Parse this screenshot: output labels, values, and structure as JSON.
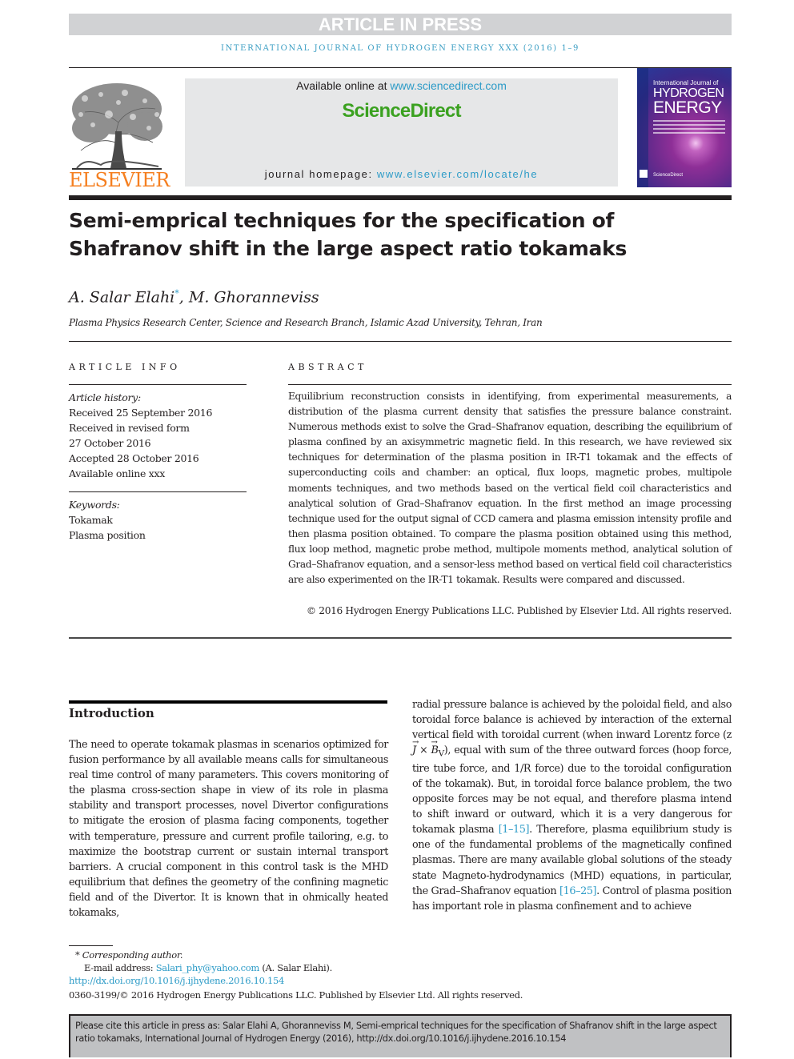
{
  "banner": {
    "label": "ARTICLE IN PRESS"
  },
  "running_head": "INTERNATIONAL JOURNAL OF HYDROGEN ENERGY XXX (2016) 1–9",
  "header": {
    "publisher_logo": "ELSEVIER",
    "available_online_prefix": "Available online at ",
    "available_online_link": "www.sciencedirect.com",
    "brand": "ScienceDirect",
    "homepage_prefix": "journal homepage: ",
    "homepage_link": "www.elsevier.com/locate/he",
    "cover": {
      "line1": "International Journal of",
      "line2": "HYDROGEN",
      "line3": "ENERGY",
      "footer": "ScienceDirect"
    }
  },
  "article": {
    "title": "Semi-emprical techniques for the specification of Shafranov shift in the large aspect ratio tokamaks",
    "authors": [
      {
        "name": "A. Salar Elahi",
        "mark": "*"
      },
      {
        "name": "M. Ghoranneviss",
        "mark": ""
      }
    ],
    "author_separator": ", ",
    "affiliation": "Plasma Physics Research Center, Science and Research Branch, Islamic Azad University, Tehran, Iran"
  },
  "article_info": {
    "heading": "ARTICLE INFO",
    "history_label": "Article history:",
    "history": [
      "Received 25 September 2016",
      "Received in revised form",
      "27 October 2016",
      "Accepted 28 October 2016",
      "Available online xxx"
    ],
    "keywords_label": "Keywords:",
    "keywords": [
      "Tokamak",
      "Plasma position"
    ]
  },
  "abstract": {
    "heading": "ABSTRACT",
    "text": "Equilibrium reconstruction consists in identifying, from experimental measurements, a distribution of the plasma current density that satisfies the pressure balance constraint. Numerous methods exist to solve the Grad–Shafranov equation, describing the equilib­rium of plasma confined by an axisymmetric magnetic field. In this research, we have reviewed six techniques for determination of the plasma position in IR-T1 tokamak and the effects of superconducting coils and chamber: an optical, flux loops, magnetic probes, multipole moments techniques, and two methods based on the vertical field coil charac­teristics and analytical solution of Grad–Shafranov equation. In the first method an image processing technique used for the output signal of CCD camera and plasma emission in­tensity profile and then plasma position obtained. To compare the plasma position ob­tained using this method, flux loop method, magnetic probe method, multipole moments method, analytical solution of Grad–Shafranov equation, and a sensor-less method based on vertical field coil characteristics are also experimented on the IR-T1 tokamak. Results were compared and discussed.",
    "copyright": "© 2016 Hydrogen Energy Publications LLC. Published by Elsevier Ltd. All rights reserved."
  },
  "body": {
    "section_heading": "Introduction",
    "left_column": "The need to operate tokamak plasmas in scenarios optimized for fusion performance by all available means calls for simultaneous real time control of many parameters. This covers monitoring of the plasma cross-section shape in view of its role in plasma stability and transport processes, novel Divertor configurations to mitigate the erosion of plasma facing components, together with temperature, pressure and current profile tailoring, e.g. to maximize the bootstrap cur­rent or sustain internal transport barriers. A crucial compo­nent in this control task is the MHD equilibrium that defines the geometry of the confining magnetic field and of the Divertor. It is known that in ohmically heated tokamaks,",
    "right_column": {
      "p1": "radial pressure balance is achieved by the poloidal field, and also toroidal force balance is achieved by interaction of the external vertical field with toroidal current (when inward Lorentz force (z",
      "vec_j": "J",
      "times": " × ",
      "vec_b": "B",
      "sub_v": "V",
      "p2": "), equal with sum of the three outward forces (hoop force, tire tube force, and 1/R force) due to the toroidal configuration of the tokamak). But, in toroidal force balance problem, the two opposite forces may be not equal, and therefore plasma intend to shift inward or outward, which it is a very dangerous for tokamak plasma ",
      "ref1": "[1–15]",
      "p3": ". Therefore, plasma equilibrium study is one of the funda­mental problems of the magnetically confined plasmas. There are many available global solutions of the steady state Magneto-hydrodynamics (MHD) equations, in particular, the Grad–Shafranov equation ",
      "ref2": "[16–25]",
      "p4": ". Control of plasma position has important role in plasma confinement and to achieve"
    }
  },
  "footnotes": {
    "corresponding": "* Corresponding author.",
    "email_label": "E-mail address: ",
    "email": "Salari_phy@yahoo.com",
    "email_owner": " (A. Salar Elahi).",
    "doi_link": "http://dx.doi.org/10.1016/j.ijhydene.2016.10.154",
    "issn_copyright": "0360-3199/© 2016 Hydrogen Energy Publications LLC. Published by Elsevier Ltd. All rights reserved."
  },
  "citation_box": "Please cite this article in press as: Salar Elahi A, Ghoranneviss M, Semi-emprical techniques for the specification of Shafranov shift in the large aspect ratio tokamaks, International Journal of Hydrogen Energy (2016), http://dx.doi.org/10.1016/j.ijhydene.2016.10.154"
}
